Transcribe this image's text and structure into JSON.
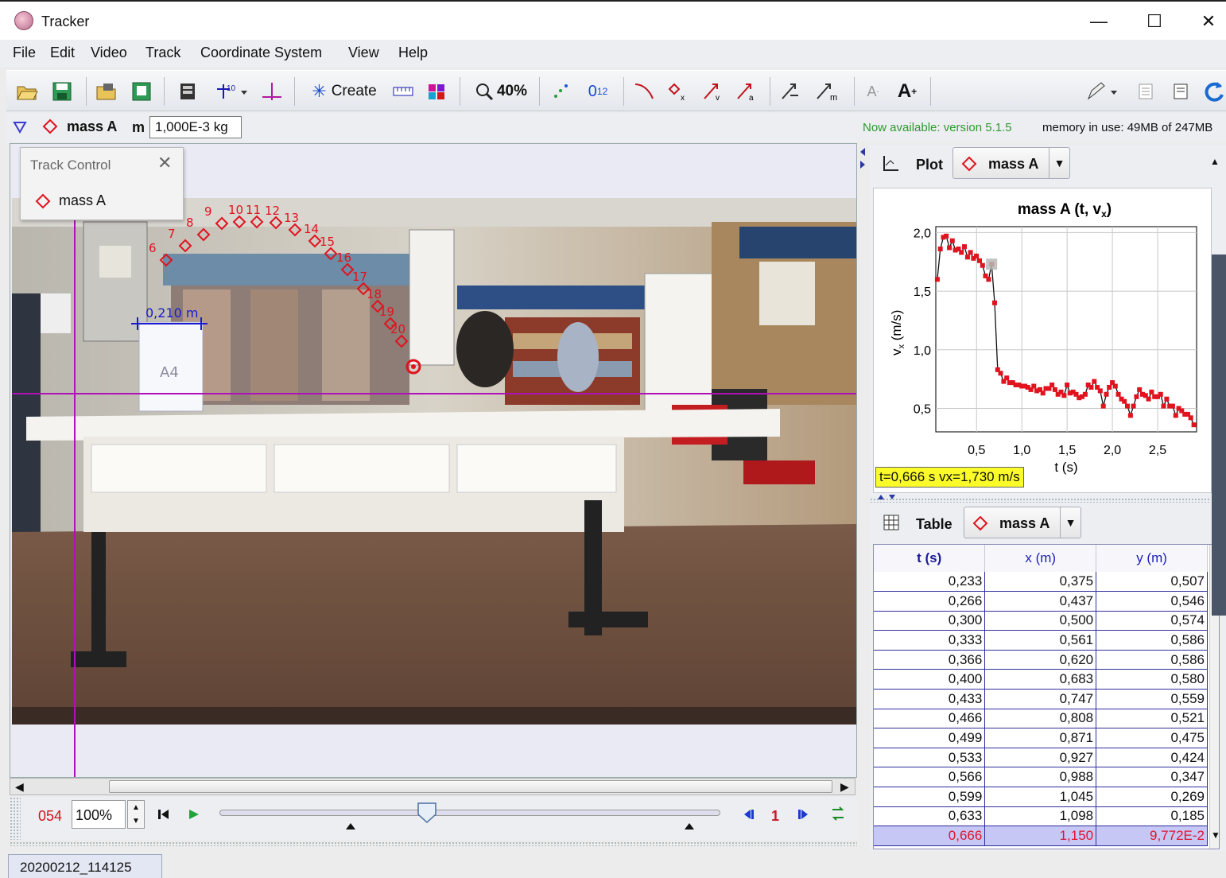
{
  "window": {
    "title": "Tracker",
    "minimize": "—",
    "maximize": "☐",
    "close": "✕"
  },
  "menu": [
    "File",
    "Edit",
    "Video",
    "Track",
    "Coordinate System",
    "View",
    "Help"
  ],
  "toolbar": {
    "create_label": "Create",
    "zoom_label": "40%",
    "sub01": "0",
    "sub12": "1",
    "sub2": "2"
  },
  "trackbar": {
    "track_name": "mass A",
    "mass_label": "m",
    "mass_value": "1,000E-3 kg",
    "update_notice": "Now available: version 5.1.5",
    "memory": "memory in use: 49MB of 247MB"
  },
  "track_control": {
    "title": "Track Control",
    "item": "mass A"
  },
  "video": {
    "calibration_label": "0,210 m",
    "paper_text": "A4",
    "point_labels": [
      "6",
      "7",
      "8",
      "9",
      "10",
      "11",
      "12",
      "13",
      "14",
      "15",
      "16",
      "17",
      "18",
      "19",
      "20"
    ]
  },
  "player": {
    "frame": "054",
    "rate": "100%",
    "step": "1"
  },
  "plot": {
    "tab_label": "Plot",
    "track": "mass A",
    "title_main": "mass A (t, v",
    "title_sub": "x",
    "title_end": ")",
    "ylabel_main": "v",
    "ylabel_sub": "x",
    "ylabel_end": " (m/s)",
    "xlabel": "t (s)",
    "readout": "t=0,666 s  vx=1,730 m/s",
    "marker_color": "#e0131f"
  },
  "chart_data": {
    "type": "scatter",
    "title": "mass A (t, vx)",
    "xlabel": "t (s)",
    "ylabel": "vx (m/s)",
    "xlim": [
      0.05,
      2.93
    ],
    "ylim": [
      0.3,
      2.05
    ],
    "x_ticks": [
      "0,5",
      "1,0",
      "1,5",
      "2,0",
      "2,5"
    ],
    "x_tick_values": [
      0.5,
      1.0,
      1.5,
      2.0,
      2.5
    ],
    "y_ticks": [
      "0,5",
      "1,0",
      "1,5",
      "2,0"
    ],
    "y_tick_values": [
      0.5,
      1.0,
      1.5,
      2.0
    ],
    "grid": true,
    "connected": true,
    "selected_point": [
      0.666,
      1.73
    ],
    "x": [
      0.067,
      0.1,
      0.133,
      0.166,
      0.2,
      0.233,
      0.266,
      0.3,
      0.333,
      0.366,
      0.4,
      0.433,
      0.466,
      0.499,
      0.533,
      0.566,
      0.599,
      0.633,
      0.666,
      0.7,
      0.733,
      0.766,
      0.8,
      0.833,
      0.866,
      0.9,
      0.933,
      0.966,
      1.0,
      1.033,
      1.066,
      1.1,
      1.133,
      1.166,
      1.2,
      1.233,
      1.266,
      1.3,
      1.333,
      1.366,
      1.4,
      1.433,
      1.466,
      1.5,
      1.533,
      1.566,
      1.6,
      1.633,
      1.666,
      1.7,
      1.733,
      1.766,
      1.8,
      1.833,
      1.866,
      1.9,
      1.933,
      1.966,
      2.0,
      2.033,
      2.066,
      2.1,
      2.133,
      2.166,
      2.2,
      2.233,
      2.266,
      2.3,
      2.333,
      2.366,
      2.4,
      2.433,
      2.466,
      2.5,
      2.533,
      2.566,
      2.6,
      2.633,
      2.666,
      2.7,
      2.733,
      2.766,
      2.8,
      2.833,
      2.866,
      2.9
    ],
    "y": [
      1.6,
      1.86,
      1.96,
      1.97,
      1.87,
      1.93,
      1.85,
      1.86,
      1.83,
      1.88,
      1.79,
      1.83,
      1.78,
      1.8,
      1.76,
      1.72,
      1.63,
      1.6,
      1.73,
      1.4,
      0.83,
      0.8,
      0.73,
      0.76,
      0.72,
      0.72,
      0.7,
      0.7,
      0.69,
      0.69,
      0.68,
      0.66,
      0.69,
      0.65,
      0.66,
      0.63,
      0.67,
      0.67,
      0.7,
      0.66,
      0.62,
      0.64,
      0.61,
      0.7,
      0.63,
      0.64,
      0.62,
      0.59,
      0.6,
      0.62,
      0.7,
      0.68,
      0.73,
      0.68,
      0.65,
      0.52,
      0.62,
      0.68,
      0.72,
      0.69,
      0.62,
      0.58,
      0.56,
      0.52,
      0.44,
      0.52,
      0.6,
      0.66,
      0.62,
      0.61,
      0.58,
      0.64,
      0.6,
      0.6,
      0.62,
      0.52,
      0.58,
      0.52,
      0.52,
      0.44,
      0.5,
      0.48,
      0.45,
      0.45,
      0.42,
      0.36
    ]
  },
  "table": {
    "tab_label": "Table",
    "track": "mass A",
    "headers": [
      "t (s)",
      "x (m)",
      "y (m)"
    ],
    "rows": [
      [
        "0,233",
        "0,375",
        "0,507"
      ],
      [
        "0,266",
        "0,437",
        "0,546"
      ],
      [
        "0,300",
        "0,500",
        "0,574"
      ],
      [
        "0,333",
        "0,561",
        "0,586"
      ],
      [
        "0,366",
        "0,620",
        "0,586"
      ],
      [
        "0,400",
        "0,683",
        "0,580"
      ],
      [
        "0,433",
        "0,747",
        "0,559"
      ],
      [
        "0,466",
        "0,808",
        "0,521"
      ],
      [
        "0,499",
        "0,871",
        "0,475"
      ],
      [
        "0,533",
        "0,927",
        "0,424"
      ],
      [
        "0,566",
        "0,988",
        "0,347"
      ],
      [
        "0,599",
        "1,045",
        "0,269"
      ],
      [
        "0,633",
        "1,098",
        "0,185"
      ],
      [
        "0,666",
        "1,150",
        "9,772E-2"
      ]
    ]
  },
  "bottom_tab": "20200212_114125"
}
